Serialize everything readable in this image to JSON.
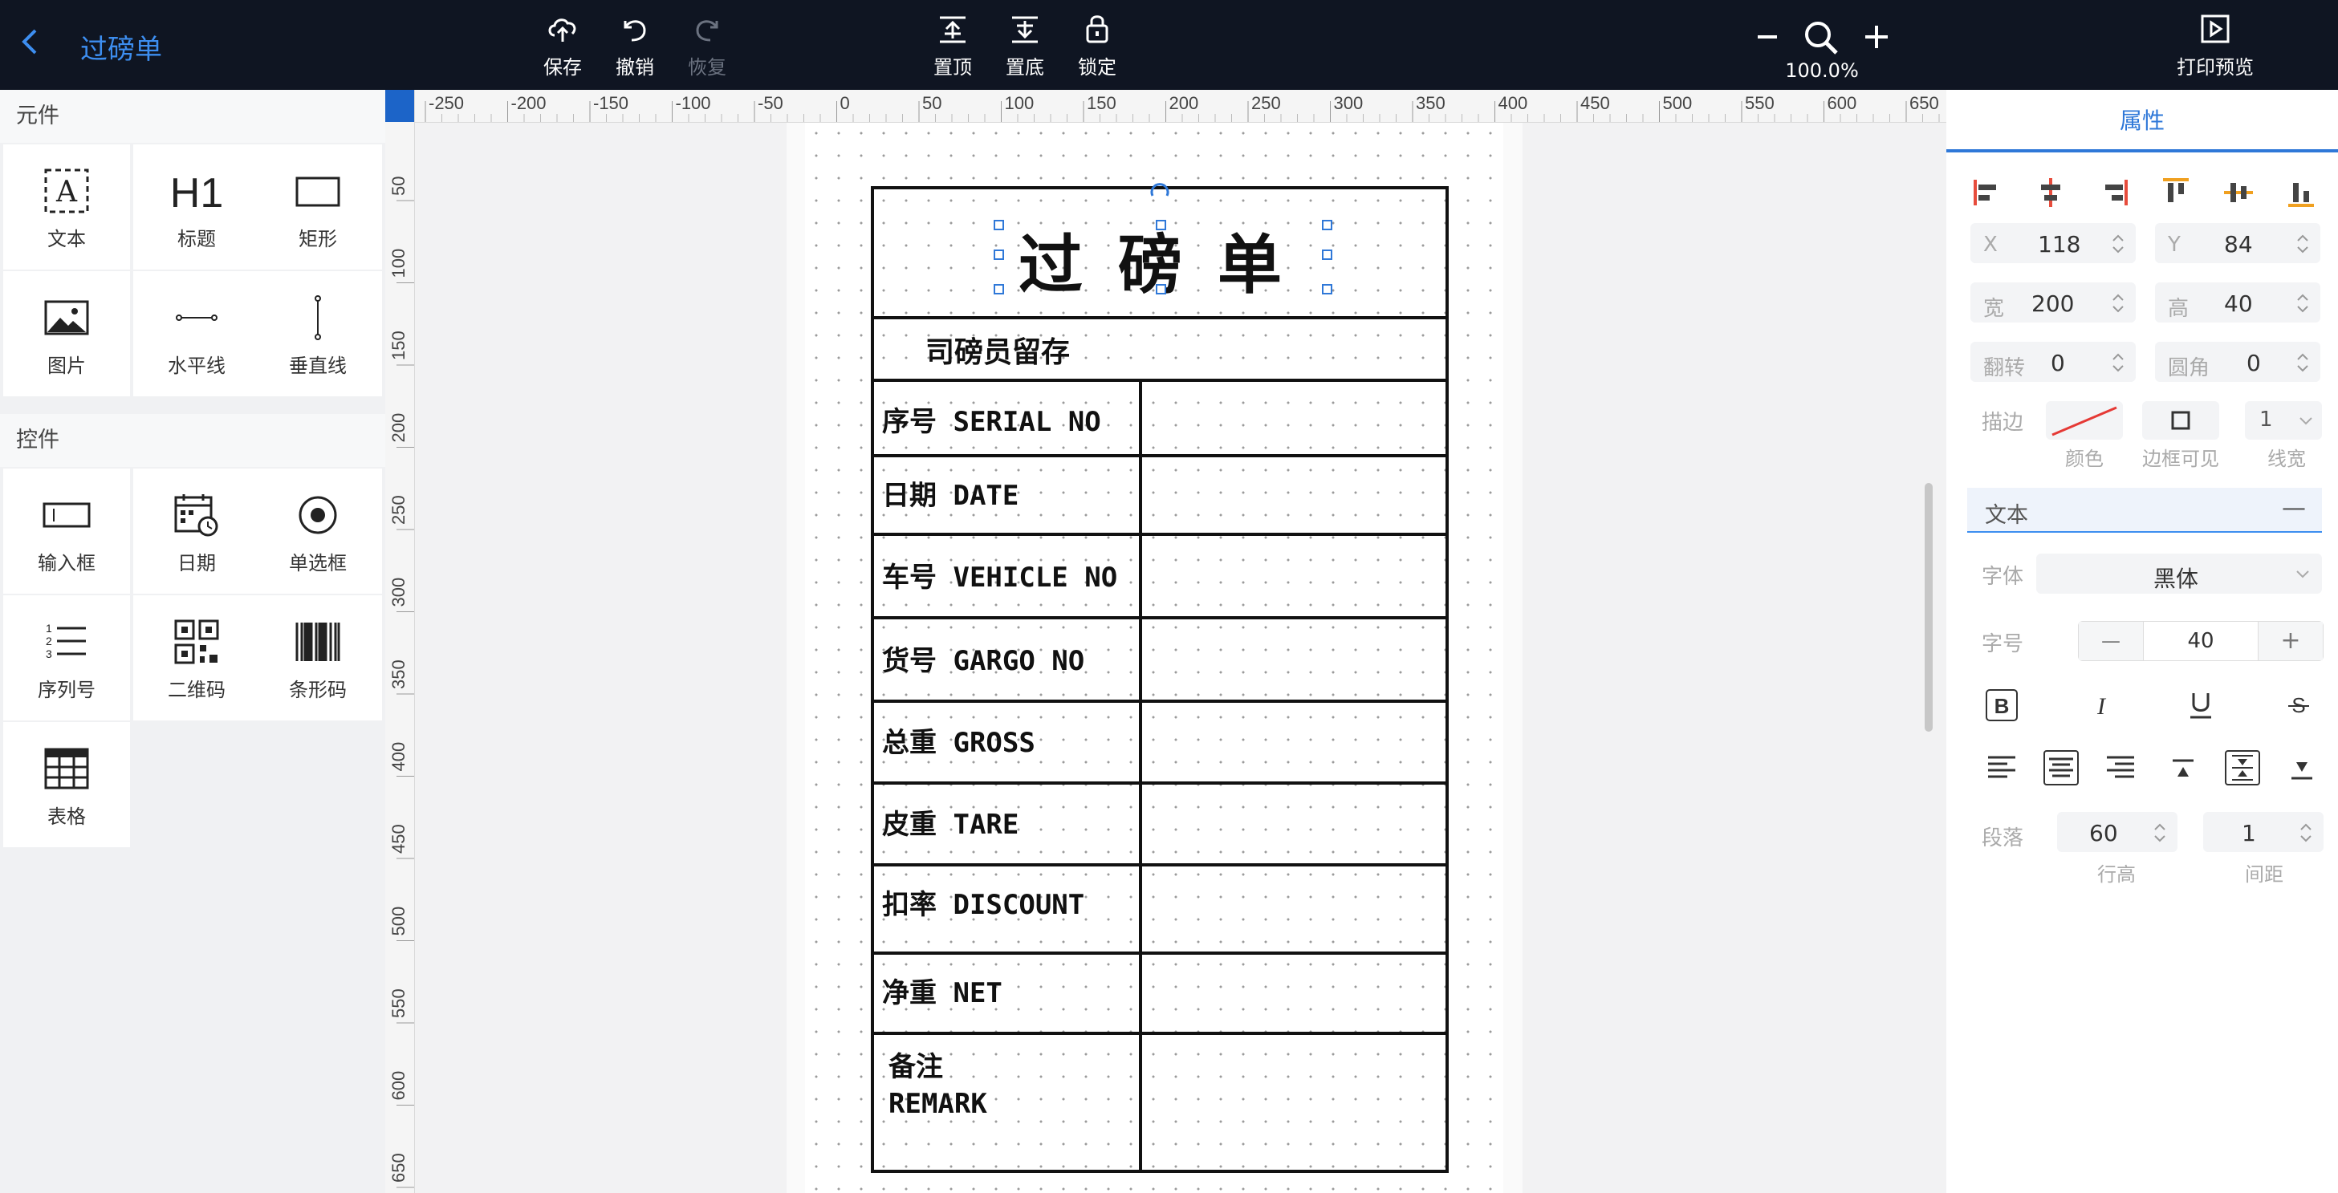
{
  "header": {
    "title": "过磅单",
    "actions": [
      {
        "label": "保存",
        "icon": "upload-cloud-icon",
        "enabled": true
      },
      {
        "label": "撤销",
        "icon": "undo-icon",
        "enabled": true
      },
      {
        "label": "恢复",
        "icon": "redo-icon",
        "enabled": false
      },
      {
        "label": "置顶",
        "icon": "bring-to-front-icon",
        "enabled": true
      },
      {
        "label": "置底",
        "icon": "send-to-back-icon",
        "enabled": true
      },
      {
        "label": "锁定",
        "icon": "lock-icon",
        "enabled": true
      }
    ],
    "zoom": "100.0%",
    "print_preview": "打印预览"
  },
  "components": {
    "heading": "元件",
    "items": [
      {
        "label": "文本",
        "icon": "text-box-icon"
      },
      {
        "label": "标题",
        "icon": "heading-h1-icon",
        "glyph": "H1"
      },
      {
        "label": "矩形",
        "icon": "rectangle-icon"
      },
      {
        "label": "图片",
        "icon": "image-icon"
      },
      {
        "label": "水平线",
        "icon": "horizontal-line-icon"
      },
      {
        "label": "垂直线",
        "icon": "vertical-line-icon"
      }
    ]
  },
  "controls": {
    "heading": "控件",
    "items": [
      {
        "label": "输入框",
        "icon": "input-box-icon"
      },
      {
        "label": "日期",
        "icon": "calendar-icon"
      },
      {
        "label": "单选框",
        "icon": "radio-icon"
      },
      {
        "label": "序列号",
        "icon": "numbered-list-icon"
      },
      {
        "label": "二维码",
        "icon": "qr-code-icon"
      },
      {
        "label": "条形码",
        "icon": "barcode-icon"
      },
      {
        "label": "表格",
        "icon": "table-icon"
      }
    ]
  },
  "ruler": {
    "top": [
      "-250",
      "-200",
      "-150",
      "-100",
      "-50",
      "0",
      "50",
      "100",
      "150",
      "200",
      "250",
      "300",
      "350",
      "400",
      "450",
      "500",
      "550",
      "600",
      "650"
    ],
    "left": [
      "50",
      "100",
      "150",
      "200",
      "250",
      "300",
      "350",
      "400",
      "450",
      "500",
      "550",
      "600",
      "650"
    ]
  },
  "ticket": {
    "title": "过磅单",
    "subtitle": "司磅员留存",
    "rows": [
      {
        "label": "序号 SERIAL NO"
      },
      {
        "label": "日期 DATE"
      },
      {
        "label": "车号 VEHICLE NO"
      },
      {
        "label": "货号 GARGO NO"
      },
      {
        "label": "总重 GROSS"
      },
      {
        "label": "皮重 TARE"
      },
      {
        "label": "扣率 DISCOUNT"
      },
      {
        "label": "净重 NET"
      }
    ],
    "remark_line1": "备注",
    "remark_line2": "REMARK"
  },
  "properties": {
    "tab": "属性",
    "x_label": "X",
    "x_value": "118",
    "y_label": "Y",
    "y_value": "84",
    "w_label": "宽",
    "w_value": "200",
    "h_label": "高",
    "h_value": "40",
    "rotate_label": "翻转",
    "rotate_value": "0",
    "radius_label": "圆角",
    "radius_value": "0",
    "stroke_label": "描边",
    "color_label": "颜色",
    "border_visible_label": "边框可见",
    "line_width_value": "1",
    "line_width_label": "线宽",
    "text_section": "文本",
    "text_section_toggle": "—",
    "font_label": "字体",
    "font_value": "黑体",
    "size_label": "字号",
    "size_value": "40",
    "size_minus": "—",
    "size_plus": "+",
    "para_label": "段落",
    "line_height_value": "60",
    "line_height_label": "行高",
    "spacing_value": "1",
    "spacing_label": "间距"
  }
}
